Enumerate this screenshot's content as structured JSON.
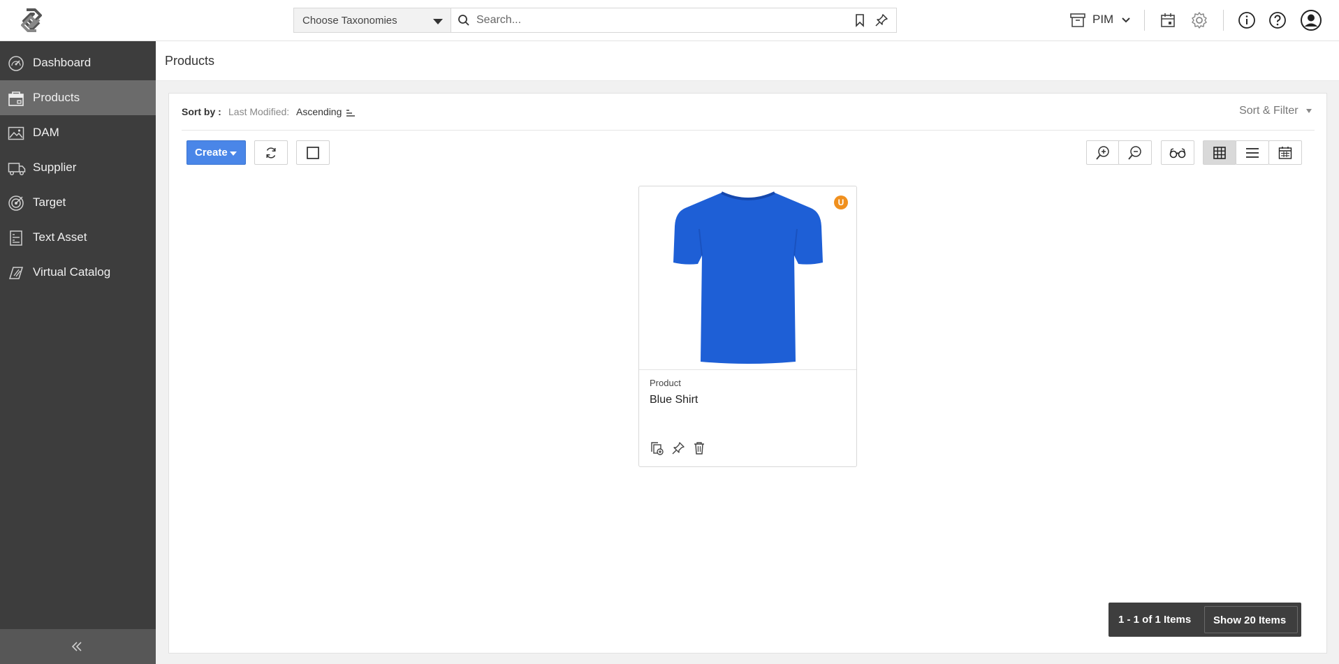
{
  "header": {
    "taxonomy_select": "Choose Taxonomies",
    "search_placeholder": "Search...",
    "module": "PIM"
  },
  "sidebar": {
    "items": [
      {
        "label": "Dashboard",
        "icon": "speedometer-icon"
      },
      {
        "label": "Products",
        "icon": "product-box-icon",
        "active": true
      },
      {
        "label": "DAM",
        "icon": "image-icon"
      },
      {
        "label": "Supplier",
        "icon": "truck-icon"
      },
      {
        "label": "Target",
        "icon": "target-icon"
      },
      {
        "label": "Text Asset",
        "icon": "text-document-icon"
      },
      {
        "label": "Virtual Catalog",
        "icon": "catalog-icon"
      }
    ]
  },
  "page": {
    "title": "Products"
  },
  "sort": {
    "label": "Sort by :",
    "field": "Last Modified:",
    "direction": "Ascending",
    "filter_label": "Sort & Filter"
  },
  "toolbar": {
    "create_label": "Create"
  },
  "products": [
    {
      "type": "Product",
      "name": "Blue Shirt",
      "badge": "U",
      "image_color": "#1e5fd6"
    }
  ],
  "pager": {
    "count_label": "1 - 1 of 1 Items",
    "show_label": "Show 20 Items"
  },
  "colors": {
    "sidebar": "#3d3d3d",
    "sidebar_active": "#6b6b6b",
    "primary": "#4a86e8",
    "badge": "#f0901e"
  }
}
